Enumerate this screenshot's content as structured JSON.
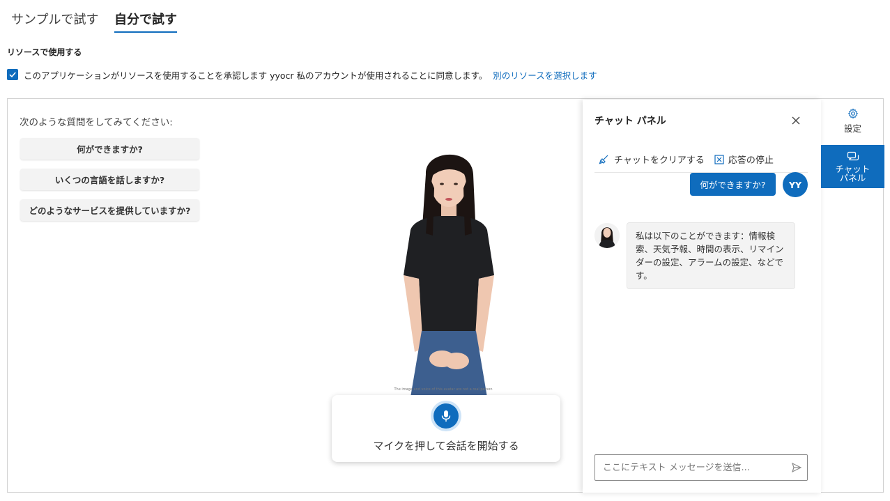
{
  "tabs": [
    "サンプルで試す",
    "自分で試す"
  ],
  "active_tab": "自分で試す",
  "section_title": "リソースで使用する",
  "consent": {
    "checked": true,
    "text": "このアプリケーションがリソースを使用することを承認します yyocr 私のアカウントが使用されることに同意します。",
    "link": "別のリソースを選択します"
  },
  "prompt_title": "次のような質問をしてみてください:",
  "suggestions": [
    "何ができますか?",
    "いくつの言語を話しますか?",
    "どのようなサービスを提供していますか?"
  ],
  "avatar_caption": "The image and voice of this avatar are not a real person",
  "mic": {
    "label": "マイクを押して会話を開始する",
    "icon": "microphone-icon"
  },
  "chat": {
    "title": "チャット パネル",
    "actions": {
      "clear": "チャットをクリアする",
      "stop": "応答の停止"
    },
    "messages": [
      {
        "role": "user",
        "text": "何ができますか?",
        "avatar": "YY"
      },
      {
        "role": "assistant",
        "text": "私は以下のことができます：情報検索、天気予報、時間の表示、リマインダーの設定、アラームの設定、などです。"
      }
    ],
    "input_placeholder": "ここにテキスト メッセージを送信..."
  },
  "sidebar": {
    "settings_label": "設定",
    "chat_panel_label_line1": "チャット",
    "chat_panel_label_line2": "パネル"
  },
  "colors": {
    "accent": "#0f6cbd",
    "bubble": "#f3f3f3"
  }
}
